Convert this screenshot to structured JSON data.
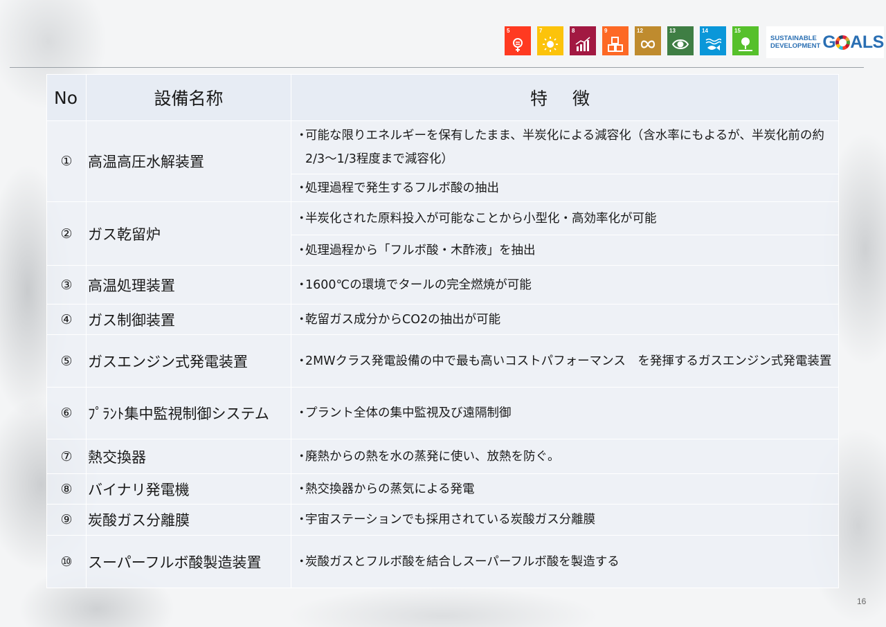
{
  "sdg_logos": [
    {
      "number": "5",
      "color": "#ff3a21",
      "icon": "gender-equality-icon"
    },
    {
      "number": "7",
      "color": "#fcc30b",
      "icon": "sun-energy-icon"
    },
    {
      "number": "8",
      "color": "#a21942",
      "icon": "growth-chart-icon"
    },
    {
      "number": "9",
      "color": "#fd6925",
      "icon": "industry-cubes-icon"
    },
    {
      "number": "12",
      "color": "#bf8b2e",
      "icon": "infinity-icon"
    },
    {
      "number": "13",
      "color": "#3f7e44",
      "icon": "climate-eye-icon"
    },
    {
      "number": "14",
      "color": "#0a97d9",
      "icon": "fish-water-icon"
    },
    {
      "number": "15",
      "color": "#56c02b",
      "icon": "tree-land-icon"
    }
  ],
  "goals_logo": {
    "line1": "SUSTAINABLE",
    "line2": "DEVELOPMENT",
    "word_g": "G",
    "word_rest": "ALS"
  },
  "table": {
    "headers": {
      "no": "No",
      "name": "設備名称",
      "feature": "特 徴"
    },
    "rows": [
      {
        "no": "①",
        "name": "高温高圧水解装置",
        "features": [
          "可能な限りエネルギーを保有したまま、半炭化による減容化（含水率にもよるが、半炭化前の約2/3～1/3程度まで減容化）",
          "処理過程で発生するフルボ酸の抽出"
        ]
      },
      {
        "no": "②",
        "name": "ガス乾留炉",
        "features": [
          "半炭化された原料投入が可能なことから小型化・高効率化が可能",
          "処理過程から「フルボ酸・木酢液」を抽出"
        ]
      },
      {
        "no": "③",
        "name": "高温処理装置",
        "features": [
          "1600℃の環境でタールの完全燃焼が可能"
        ]
      },
      {
        "no": "④",
        "name": "ガス制御装置",
        "features": [
          "乾留ガス成分からCO2の抽出が可能"
        ]
      },
      {
        "no": "⑤",
        "name": "ガスエンジン式発電装置",
        "features": [
          "2MWクラス発電設備の中で最も高いコストパフォーマンス　を発揮するガスエンジン式発電装置"
        ]
      },
      {
        "no": "⑥",
        "name": "ﾌﾟﾗﾝﾄ集中監視制御システム",
        "features": [
          "プラント全体の集中監視及び遠隔制御"
        ]
      },
      {
        "no": "⑦",
        "name": "熱交換器",
        "features": [
          "廃熱からの熱を水の蒸発に使い、放熱を防ぐ。"
        ]
      },
      {
        "no": "⑧",
        "name": "バイナリ発電機",
        "features": [
          "熱交換器からの蒸気による発電"
        ]
      },
      {
        "no": "⑨",
        "name": "炭酸ガス分離膜",
        "features": [
          "宇宙ステーションでも採用されている炭酸ガス分離膜"
        ]
      },
      {
        "no": "⑩",
        "name": "スーパーフルボ酸製造装置",
        "features": [
          "炭酸ガスとフルボ酸を結合しスーパーフルボ酸を製造する"
        ]
      }
    ],
    "bullet": "・"
  },
  "page_number": "16"
}
